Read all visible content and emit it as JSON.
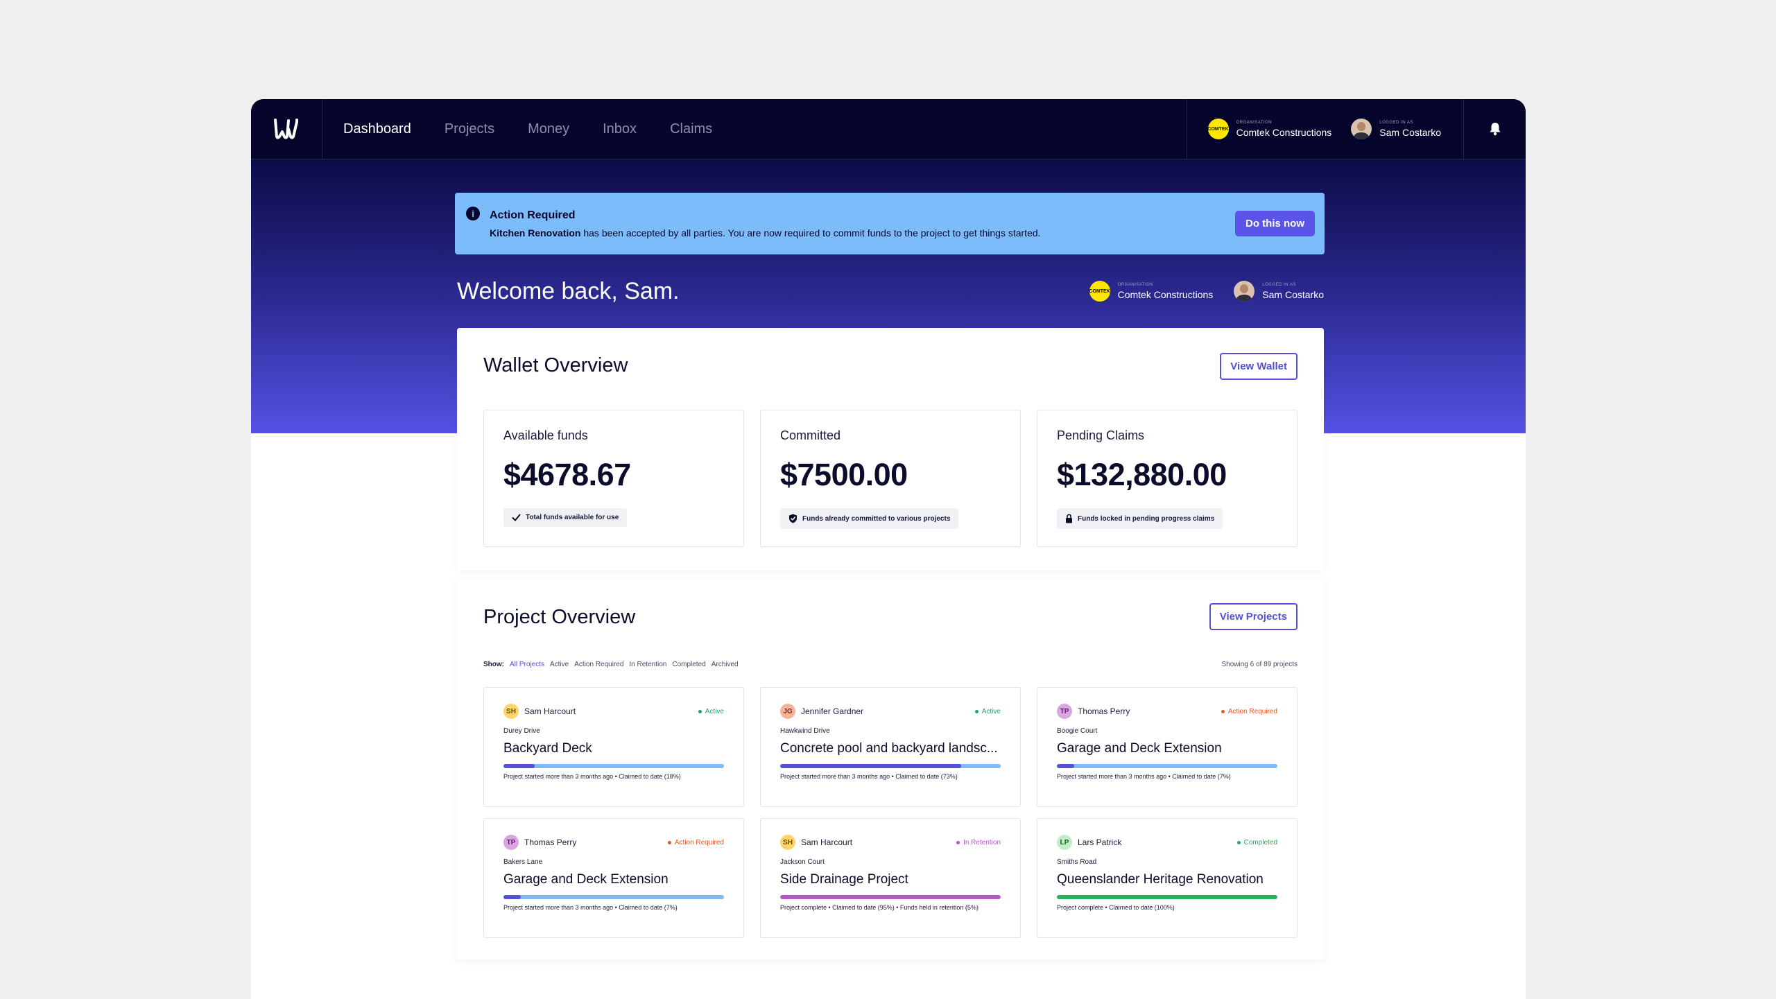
{
  "nav": {
    "links": [
      "Dashboard",
      "Projects",
      "Money",
      "Inbox",
      "Claims"
    ],
    "org_caption": "ORGANISATION",
    "org_name": "Comtek Constructions",
    "org_logo": "COMTEK",
    "user_caption": "LOGGED IN AS",
    "user_name": "Sam Costarko"
  },
  "alert": {
    "title": "Action Required",
    "project": "Kitchen Renovation",
    "message": " has been accepted by all parties. You are now required to commit funds to the project to get things started.",
    "button": "Do this now"
  },
  "welcome": "Welcome back, Sam.",
  "wallet": {
    "title": "Wallet Overview",
    "button": "View Wallet",
    "cards": [
      {
        "label": "Available funds",
        "value": "$4678.67",
        "chip": "Total funds available for use",
        "icon": "check-icon"
      },
      {
        "label": "Committed",
        "value": "$7500.00",
        "chip": "Funds already committed to various projects",
        "icon": "shield-icon"
      },
      {
        "label": "Pending Claims",
        "value": "$132,880.00",
        "chip": "Funds locked in pending progress claims",
        "icon": "lock-icon"
      }
    ]
  },
  "projects": {
    "title": "Project Overview",
    "button": "View Projects",
    "show_label": "Show:",
    "filters": [
      "All Projects",
      "Active",
      "Action Required",
      "In Retention",
      "Completed",
      "Archived"
    ],
    "count": "Showing 6 of 89 projects",
    "cards": [
      {
        "initials": "SH",
        "owner": "Sam Harcourt",
        "status": "Active",
        "street": "Durey Drive",
        "name": "Backyard Deck",
        "progress": 0.14,
        "footer": "Project started more than 3 months ago • Claimed to date (18%)"
      },
      {
        "initials": "JG",
        "owner": "Jennifer Gardner",
        "status": "Active",
        "street": "Hawkwind Drive",
        "name": "Concrete pool and backyard landsc...",
        "progress": 0.82,
        "footer": "Project started more than 3 months ago • Claimed to date (73%)"
      },
      {
        "initials": "TP",
        "owner": "Thomas Perry",
        "status": "Action Required",
        "street": "Boogie Court",
        "name": "Garage and Deck Extension",
        "progress": 0.08,
        "footer": "Project started more than 3 months ago • Claimed to date (7%)"
      },
      {
        "initials": "TP",
        "owner": "Thomas Perry",
        "status": "Action Required",
        "street": "Bakers Lane",
        "name": "Garage and Deck Extension",
        "progress": 0.08,
        "footer": "Project started more than 3 months ago • Claimed to date (7%)"
      },
      {
        "initials": "SH",
        "owner": "Sam Harcourt",
        "status": "In Retention",
        "street": "Jackson Court",
        "name": "Side Drainage Project",
        "progress": 1.0,
        "footer": "Project complete • Claimed to date (95%) • Funds held in retention (5%)"
      },
      {
        "initials": "LP",
        "owner": "Lars Patrick",
        "status": "Completed",
        "street": "Smiths Road",
        "name": "Queenslander Heritage Renovation",
        "progress": 1.0,
        "footer": "Project complete • Claimed to date (100%)"
      }
    ]
  },
  "colors": {
    "accent": "#5551d6",
    "active": "#1fa46b",
    "action_required": "#f0541e",
    "in_retention": "#b357c9",
    "completed": "#22b45a",
    "bar_track": "#7cbcfb"
  }
}
